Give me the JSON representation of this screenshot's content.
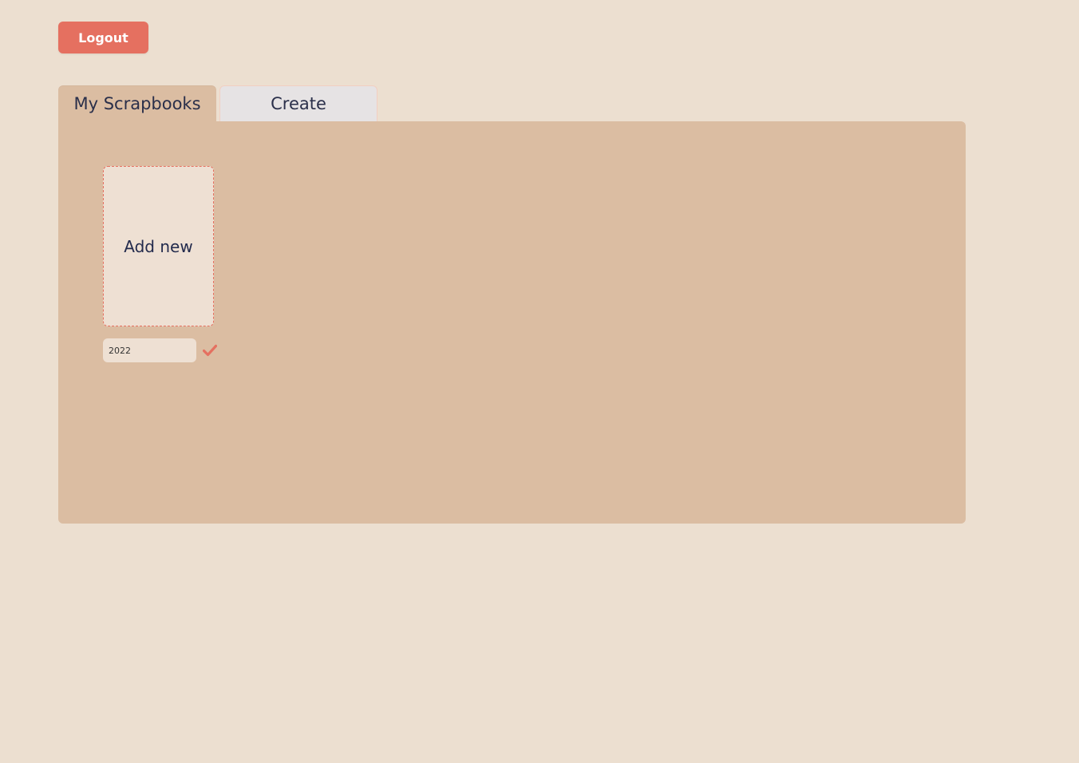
{
  "header": {
    "logout_label": "Logout"
  },
  "tabs": [
    {
      "label": "My Scrapbooks",
      "active": true
    },
    {
      "label": "Create",
      "active": false
    }
  ],
  "scrapbooks": {
    "add_new_label": "Add new",
    "name_input_value": "2022",
    "confirm_icon": "checkmark-icon"
  },
  "colors": {
    "accent": "#e57060",
    "background": "#ecdfd0",
    "panel": "#dbbda2",
    "text": "#232b4d"
  }
}
